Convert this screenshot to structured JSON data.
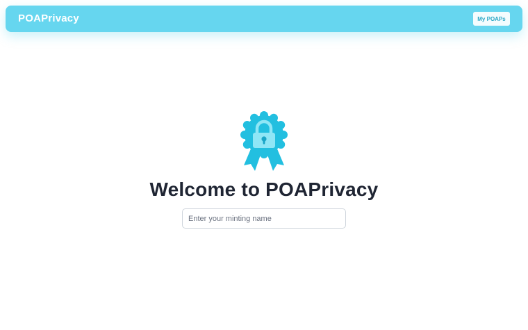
{
  "navbar": {
    "brand": "POAPrivacy",
    "my_poaps_label": "My POAPs"
  },
  "hero": {
    "icon": "lock-badge-icon",
    "title": "Welcome to POAPrivacy"
  },
  "minting_input": {
    "value": "",
    "placeholder": "Enter your minting name"
  },
  "colors": {
    "navbar_bg": "#66d6ef",
    "badge_primary": "#22bfe0",
    "badge_light": "#8fe6f6",
    "title_text": "#1f2533",
    "button_text": "#2aa7c6"
  }
}
